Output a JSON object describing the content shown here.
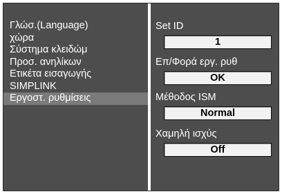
{
  "menu": {
    "items": [
      {
        "label": "Γλώσ.(Language)"
      },
      {
        "label": "χώρα"
      },
      {
        "label": "Σύστημα κλειδώμ"
      },
      {
        "label": "Προσ. ανηλίκων"
      },
      {
        "label": "Ετικέτα εισαγωγής"
      },
      {
        "label": "SIMPLINK"
      },
      {
        "label": "Εργοστ. ρυθμίσεις"
      }
    ],
    "selected_index": 6
  },
  "settings": [
    {
      "label": "Set ID",
      "value": "1"
    },
    {
      "label": "Επ/Φορά εργ. ρυθ",
      "value": "OK"
    },
    {
      "label": "Μέθοδος ISM",
      "value": "Normal"
    },
    {
      "label": "Χαμηλή ισχύς",
      "value": "Off"
    }
  ],
  "colors": {
    "panel": "#4d4d4d",
    "selected_row": "#7a7a7a",
    "divider": "#ffffff",
    "text": "#ffffff",
    "value_box": "#f2f2f2"
  }
}
